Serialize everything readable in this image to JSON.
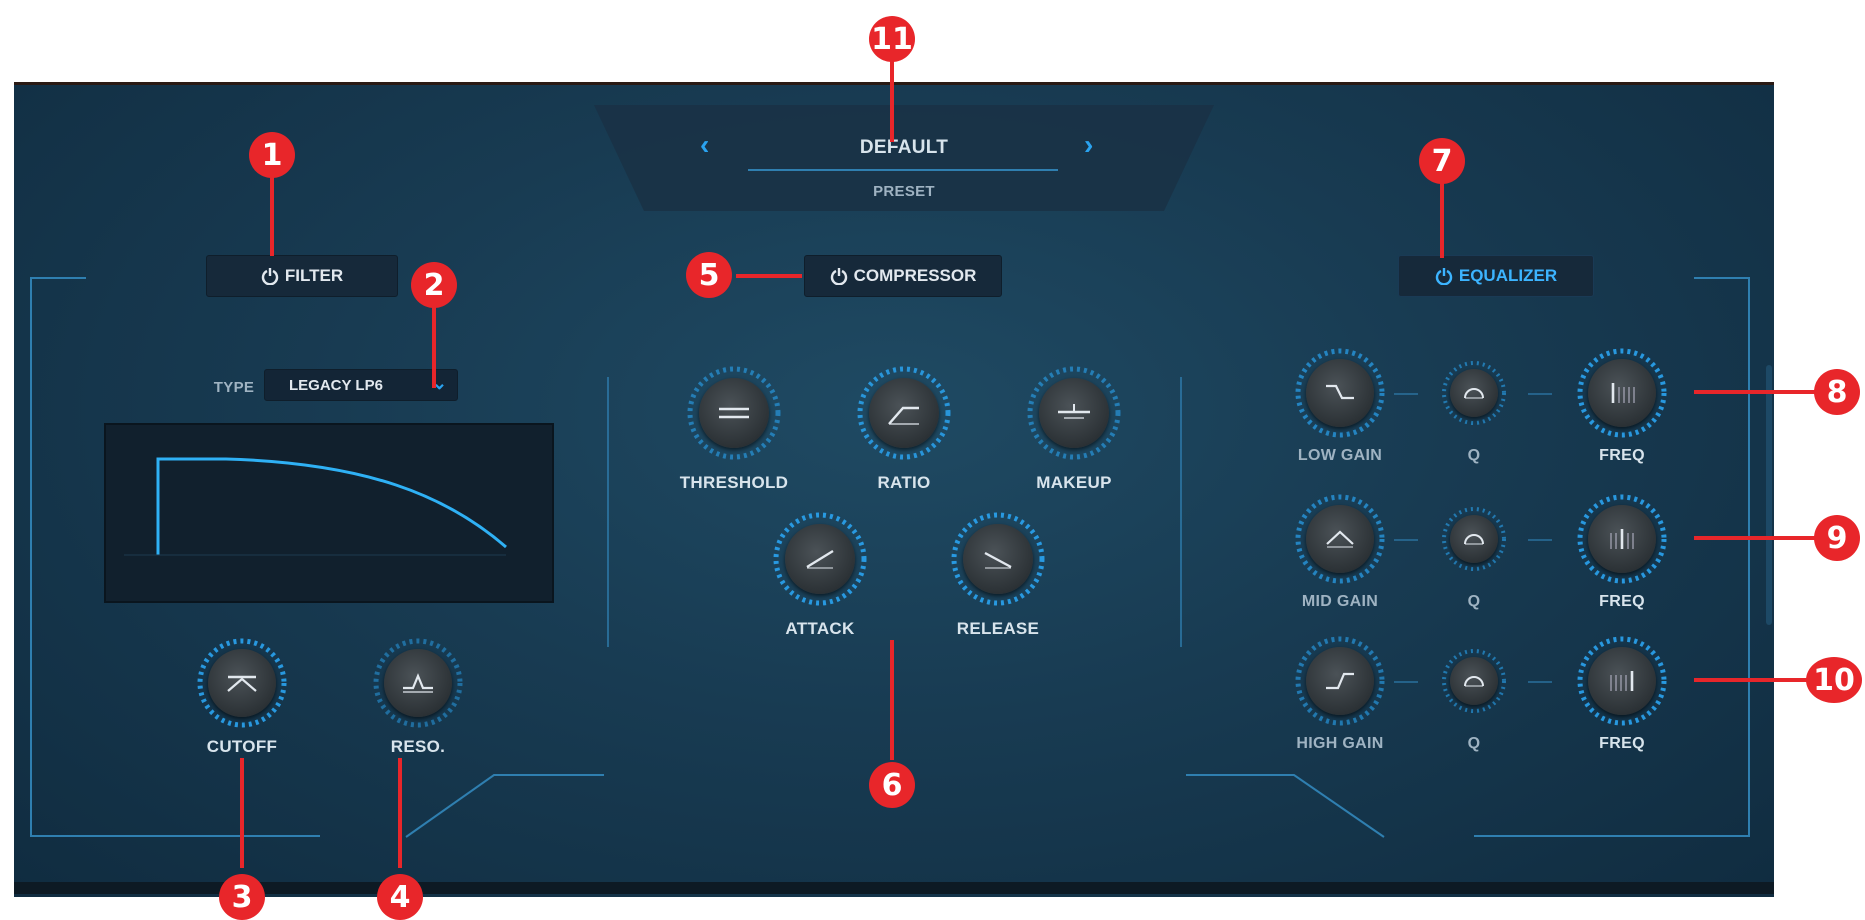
{
  "preset": {
    "name": "DEFAULT",
    "label": "PRESET",
    "prev_icon": "chevron-left-icon",
    "next_icon": "chevron-right-icon"
  },
  "filter": {
    "button_label": "FILTER",
    "type_label": "TYPE",
    "type_value": "LEGACY LP6",
    "knobs": {
      "cutoff": "CUTOFF",
      "reso": "RESO."
    }
  },
  "compressor": {
    "button_label": "COMPRESSOR",
    "knobs": {
      "threshold": "THRESHOLD",
      "ratio": "RATIO",
      "makeup": "MAKEUP",
      "attack": "ATTACK",
      "release": "RELEASE"
    }
  },
  "equalizer": {
    "button_label": "EQUALIZER",
    "rows": [
      {
        "gain": "LOW GAIN",
        "q": "Q",
        "freq": "FREQ"
      },
      {
        "gain": "MID GAIN",
        "q": "Q",
        "freq": "FREQ"
      },
      {
        "gain": "HIGH GAIN",
        "q": "Q",
        "freq": "FREQ"
      }
    ]
  },
  "callouts": [
    "1",
    "2",
    "3",
    "4",
    "5",
    "6",
    "7",
    "8",
    "9",
    "10",
    "11"
  ],
  "colors": {
    "accent": "#2aa3f0",
    "callout": "#e8262a",
    "panel": "#183b52"
  }
}
